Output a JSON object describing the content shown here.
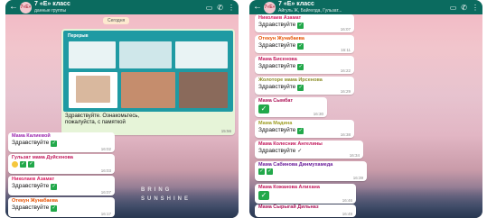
{
  "left": {
    "title": "7 «Е» класс",
    "subtitle": "данные группы",
    "avatar_text": "7«Е»",
    "date_chip": "Сегодня",
    "image": {
      "poster_title": "Перерыв",
      "caption_line1": "Здравствуйте. Ознакомьтесь,",
      "caption_line2": "пожалуйста, с памяткой",
      "time": "15:56"
    },
    "messages": [
      {
        "sender": "Мама Калиевой",
        "text": "Здравствуйте",
        "time": "16:02",
        "sender_color": "#9c27b0"
      },
      {
        "sender": "Гульзат мама Дуйсенова",
        "text": "",
        "time": "16:03",
        "sender_color": "#c2185b"
      },
      {
        "sender": "Николаев Азамат",
        "text": "Здравствуйте",
        "time": "16:07",
        "sender_color": "#d81b60"
      },
      {
        "sender": "Отекун Жунабаева",
        "text": "Здравствуйте",
        "time": "16:17",
        "sender_color": "#e65100"
      }
    ],
    "watermark_line1": "BRING",
    "watermark_line2": "SUNSHINE"
  },
  "right": {
    "title": "7 «Е» класс",
    "subtitle": "Айгуль Ж, Байгелда, Гульзат...",
    "avatar_text": "7«Е»",
    "messages": [
      {
        "sender": "Николаев Азамат",
        "text": "Здравствуйте",
        "time": "16:07",
        "sender_color": "#d81b60"
      },
      {
        "sender": "Отекун Жунабаева",
        "text": "Здравствуйте",
        "time": "16:11",
        "sender_color": "#e65100"
      },
      {
        "sender": "Мама Бисенова",
        "text": "Здравствуйте",
        "time": "16:22",
        "sender_color": "#c2185b"
      },
      {
        "sender": "Жолоторе мама Ирсенова",
        "text": "Здравствуйте",
        "time": "16:29",
        "sender_color": "#8e8e2a"
      },
      {
        "sender": "Мама Сымбат",
        "text": "",
        "time": "16:30",
        "sender_color": "#ad1457"
      },
      {
        "sender": "Мама Мадина",
        "text": "Здравствуйте",
        "time": "16:38",
        "sender_color": "#9e9d24"
      },
      {
        "sender": "Мама Колесник Ангелины",
        "text": "Здравствуйте",
        "time": "16:34",
        "sender_color": "#c2185b"
      },
      {
        "sender": "Мама Сабинова Динмухамеда",
        "text": "",
        "time": "16:39",
        "sender_color": "#6a1b9a"
      },
      {
        "sender": "Мама Кожанова Алихана",
        "text": "",
        "time": "16:46",
        "sender_color": "#c2185b"
      },
      {
        "sender": "Мама Сырыгай Дильназ",
        "text": "Здравствуйте",
        "time": "16:49",
        "sender_color": "#ad1457"
      }
    ]
  },
  "colors": {
    "header": "#0b6b5f",
    "check": "#22a84a",
    "image_bubble": "#e6f4d8"
  },
  "icons": [
    "back-arrow-icon",
    "video-call-icon",
    "phone-icon",
    "more-icon",
    "check-icon"
  ]
}
